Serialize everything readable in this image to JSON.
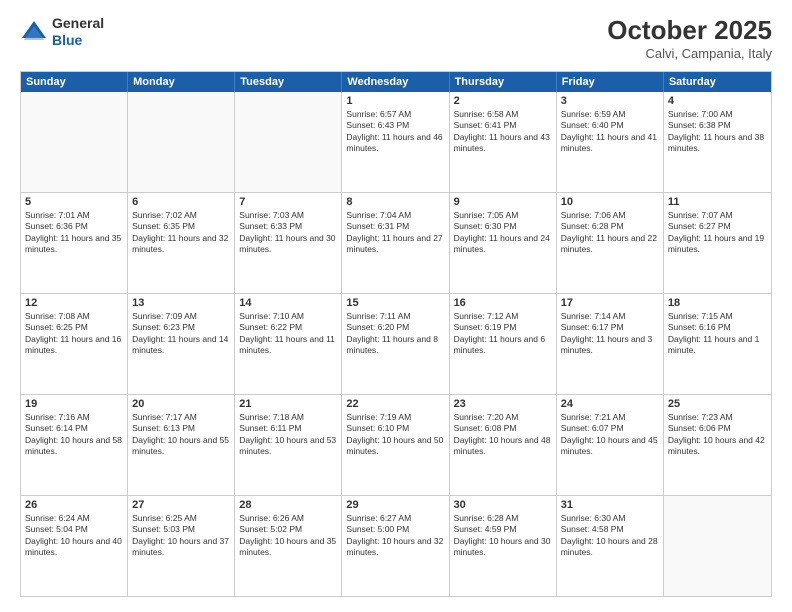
{
  "logo": {
    "general": "General",
    "blue": "Blue"
  },
  "header": {
    "month": "October 2025",
    "location": "Calvi, Campania, Italy"
  },
  "days": [
    "Sunday",
    "Monday",
    "Tuesday",
    "Wednesday",
    "Thursday",
    "Friday",
    "Saturday"
  ],
  "weeks": [
    [
      {
        "date": "",
        "info": ""
      },
      {
        "date": "",
        "info": ""
      },
      {
        "date": "",
        "info": ""
      },
      {
        "date": "1",
        "info": "Sunrise: 6:57 AM\nSunset: 6:43 PM\nDaylight: 11 hours and 46 minutes."
      },
      {
        "date": "2",
        "info": "Sunrise: 6:58 AM\nSunset: 6:41 PM\nDaylight: 11 hours and 43 minutes."
      },
      {
        "date": "3",
        "info": "Sunrise: 6:59 AM\nSunset: 6:40 PM\nDaylight: 11 hours and 41 minutes."
      },
      {
        "date": "4",
        "info": "Sunrise: 7:00 AM\nSunset: 6:38 PM\nDaylight: 11 hours and 38 minutes."
      }
    ],
    [
      {
        "date": "5",
        "info": "Sunrise: 7:01 AM\nSunset: 6:36 PM\nDaylight: 11 hours and 35 minutes."
      },
      {
        "date": "6",
        "info": "Sunrise: 7:02 AM\nSunset: 6:35 PM\nDaylight: 11 hours and 32 minutes."
      },
      {
        "date": "7",
        "info": "Sunrise: 7:03 AM\nSunset: 6:33 PM\nDaylight: 11 hours and 30 minutes."
      },
      {
        "date": "8",
        "info": "Sunrise: 7:04 AM\nSunset: 6:31 PM\nDaylight: 11 hours and 27 minutes."
      },
      {
        "date": "9",
        "info": "Sunrise: 7:05 AM\nSunset: 6:30 PM\nDaylight: 11 hours and 24 minutes."
      },
      {
        "date": "10",
        "info": "Sunrise: 7:06 AM\nSunset: 6:28 PM\nDaylight: 11 hours and 22 minutes."
      },
      {
        "date": "11",
        "info": "Sunrise: 7:07 AM\nSunset: 6:27 PM\nDaylight: 11 hours and 19 minutes."
      }
    ],
    [
      {
        "date": "12",
        "info": "Sunrise: 7:08 AM\nSunset: 6:25 PM\nDaylight: 11 hours and 16 minutes."
      },
      {
        "date": "13",
        "info": "Sunrise: 7:09 AM\nSunset: 6:23 PM\nDaylight: 11 hours and 14 minutes."
      },
      {
        "date": "14",
        "info": "Sunrise: 7:10 AM\nSunset: 6:22 PM\nDaylight: 11 hours and 11 minutes."
      },
      {
        "date": "15",
        "info": "Sunrise: 7:11 AM\nSunset: 6:20 PM\nDaylight: 11 hours and 8 minutes."
      },
      {
        "date": "16",
        "info": "Sunrise: 7:12 AM\nSunset: 6:19 PM\nDaylight: 11 hours and 6 minutes."
      },
      {
        "date": "17",
        "info": "Sunrise: 7:14 AM\nSunset: 6:17 PM\nDaylight: 11 hours and 3 minutes."
      },
      {
        "date": "18",
        "info": "Sunrise: 7:15 AM\nSunset: 6:16 PM\nDaylight: 11 hours and 1 minute."
      }
    ],
    [
      {
        "date": "19",
        "info": "Sunrise: 7:16 AM\nSunset: 6:14 PM\nDaylight: 10 hours and 58 minutes."
      },
      {
        "date": "20",
        "info": "Sunrise: 7:17 AM\nSunset: 6:13 PM\nDaylight: 10 hours and 55 minutes."
      },
      {
        "date": "21",
        "info": "Sunrise: 7:18 AM\nSunset: 6:11 PM\nDaylight: 10 hours and 53 minutes."
      },
      {
        "date": "22",
        "info": "Sunrise: 7:19 AM\nSunset: 6:10 PM\nDaylight: 10 hours and 50 minutes."
      },
      {
        "date": "23",
        "info": "Sunrise: 7:20 AM\nSunset: 6:08 PM\nDaylight: 10 hours and 48 minutes."
      },
      {
        "date": "24",
        "info": "Sunrise: 7:21 AM\nSunset: 6:07 PM\nDaylight: 10 hours and 45 minutes."
      },
      {
        "date": "25",
        "info": "Sunrise: 7:23 AM\nSunset: 6:06 PM\nDaylight: 10 hours and 42 minutes."
      }
    ],
    [
      {
        "date": "26",
        "info": "Sunrise: 6:24 AM\nSunset: 5:04 PM\nDaylight: 10 hours and 40 minutes."
      },
      {
        "date": "27",
        "info": "Sunrise: 6:25 AM\nSunset: 5:03 PM\nDaylight: 10 hours and 37 minutes."
      },
      {
        "date": "28",
        "info": "Sunrise: 6:26 AM\nSunset: 5:02 PM\nDaylight: 10 hours and 35 minutes."
      },
      {
        "date": "29",
        "info": "Sunrise: 6:27 AM\nSunset: 5:00 PM\nDaylight: 10 hours and 32 minutes."
      },
      {
        "date": "30",
        "info": "Sunrise: 6:28 AM\nSunset: 4:59 PM\nDaylight: 10 hours and 30 minutes."
      },
      {
        "date": "31",
        "info": "Sunrise: 6:30 AM\nSunset: 4:58 PM\nDaylight: 10 hours and 28 minutes."
      },
      {
        "date": "",
        "info": ""
      }
    ]
  ]
}
